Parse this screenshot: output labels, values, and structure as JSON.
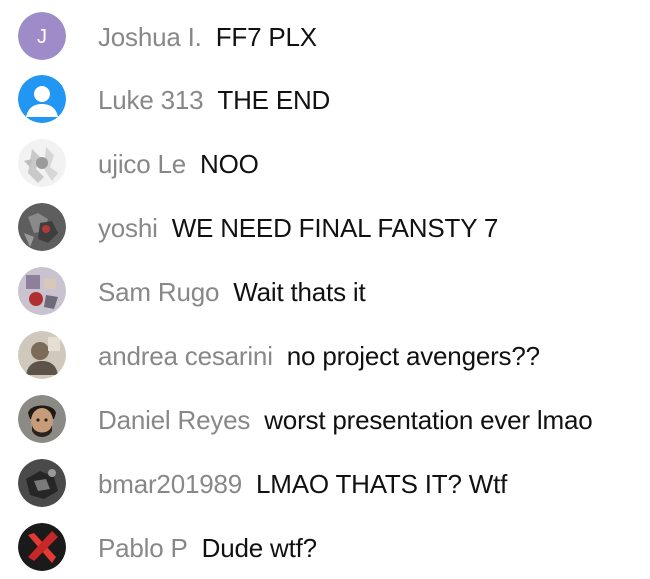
{
  "messages": [
    {
      "author": "Joshua I.",
      "text": "FF7 PLX",
      "avatar": {
        "type": "initial",
        "initial": "J",
        "color": "#9e8cc9"
      }
    },
    {
      "author": "Luke 313",
      "text": "THE END",
      "avatar": {
        "type": "default-person",
        "color": "#2196f3"
      }
    },
    {
      "author": "ujico Le",
      "text": "NOO",
      "avatar": {
        "type": "photo",
        "color": "#d8d8d8"
      }
    },
    {
      "author": "yoshi",
      "text": "WE NEED FINAL FANSTY 7",
      "avatar": {
        "type": "photo",
        "color": "#6c6c6c"
      }
    },
    {
      "author": "Sam Rugo",
      "text": "Wait thats it",
      "avatar": {
        "type": "photo",
        "color": "#b6a39a"
      }
    },
    {
      "author": "andrea cesarini",
      "text": "no project avengers??",
      "avatar": {
        "type": "photo",
        "color": "#a49a8c"
      }
    },
    {
      "author": "Daniel Reyes",
      "text": "worst presentation ever lmao",
      "avatar": {
        "type": "photo",
        "color": "#4a4038"
      }
    },
    {
      "author": "bmar201989",
      "text": "LMAO THATS IT? Wtf",
      "avatar": {
        "type": "photo",
        "color": "#3a3a3a"
      }
    },
    {
      "author": "Pablo P",
      "text": "Dude wtf?",
      "avatar": {
        "type": "x-logo",
        "color": "#1a1a1a",
        "accent": "#e53935"
      }
    }
  ]
}
